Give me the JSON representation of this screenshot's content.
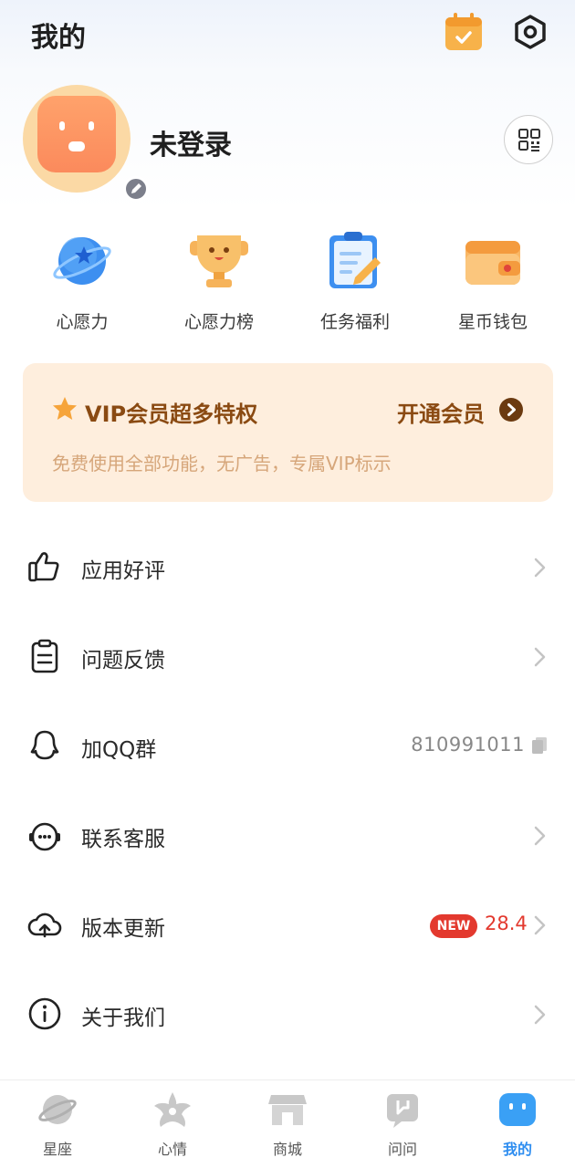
{
  "header": {
    "title": "我的",
    "calendar_icon": "calendar-check-icon",
    "settings_icon": "hexagon-settings-icon"
  },
  "profile": {
    "username": "未登录",
    "avatar_icon": "robot-face-avatar",
    "edit_icon": "pencil-icon",
    "qr_icon": "qr-code-icon"
  },
  "quick_actions": [
    {
      "label": "心愿力",
      "icon": "planet-star-icon"
    },
    {
      "label": "心愿力榜",
      "icon": "trophy-icon"
    },
    {
      "label": "任务福利",
      "icon": "clipboard-pencil-icon"
    },
    {
      "label": "星币钱包",
      "icon": "wallet-icon"
    }
  ],
  "vip": {
    "title": "VIP会员超多特权",
    "open_label": "开通会员",
    "description": "免费使用全部功能，无广告，专属VIP标示"
  },
  "menu": [
    {
      "label": "应用好评",
      "icon": "thumbs-up-icon"
    },
    {
      "label": "问题反馈",
      "icon": "clipboard-icon"
    },
    {
      "label": "加QQ群",
      "icon": "qq-penguin-icon",
      "value": "810991011"
    },
    {
      "label": "联系客服",
      "icon": "chat-bot-icon"
    },
    {
      "label": "版本更新",
      "icon": "cloud-upload-icon",
      "badge": "NEW",
      "value": "28.4"
    },
    {
      "label": "关于我们",
      "icon": "info-icon"
    }
  ],
  "tabs": [
    {
      "label": "星座",
      "icon": "planet-icon"
    },
    {
      "label": "心情",
      "icon": "star-flower-icon"
    },
    {
      "label": "商城",
      "icon": "store-icon"
    },
    {
      "label": "问问",
      "icon": "chat-square-icon"
    },
    {
      "label": "我的",
      "icon": "robot-face-icon",
      "active": true
    }
  ],
  "colors": {
    "accent": "#2f8ef0",
    "vip_text": "#8a4a12",
    "vip_bg": "#feeedd",
    "new_badge": "#e3392e"
  }
}
